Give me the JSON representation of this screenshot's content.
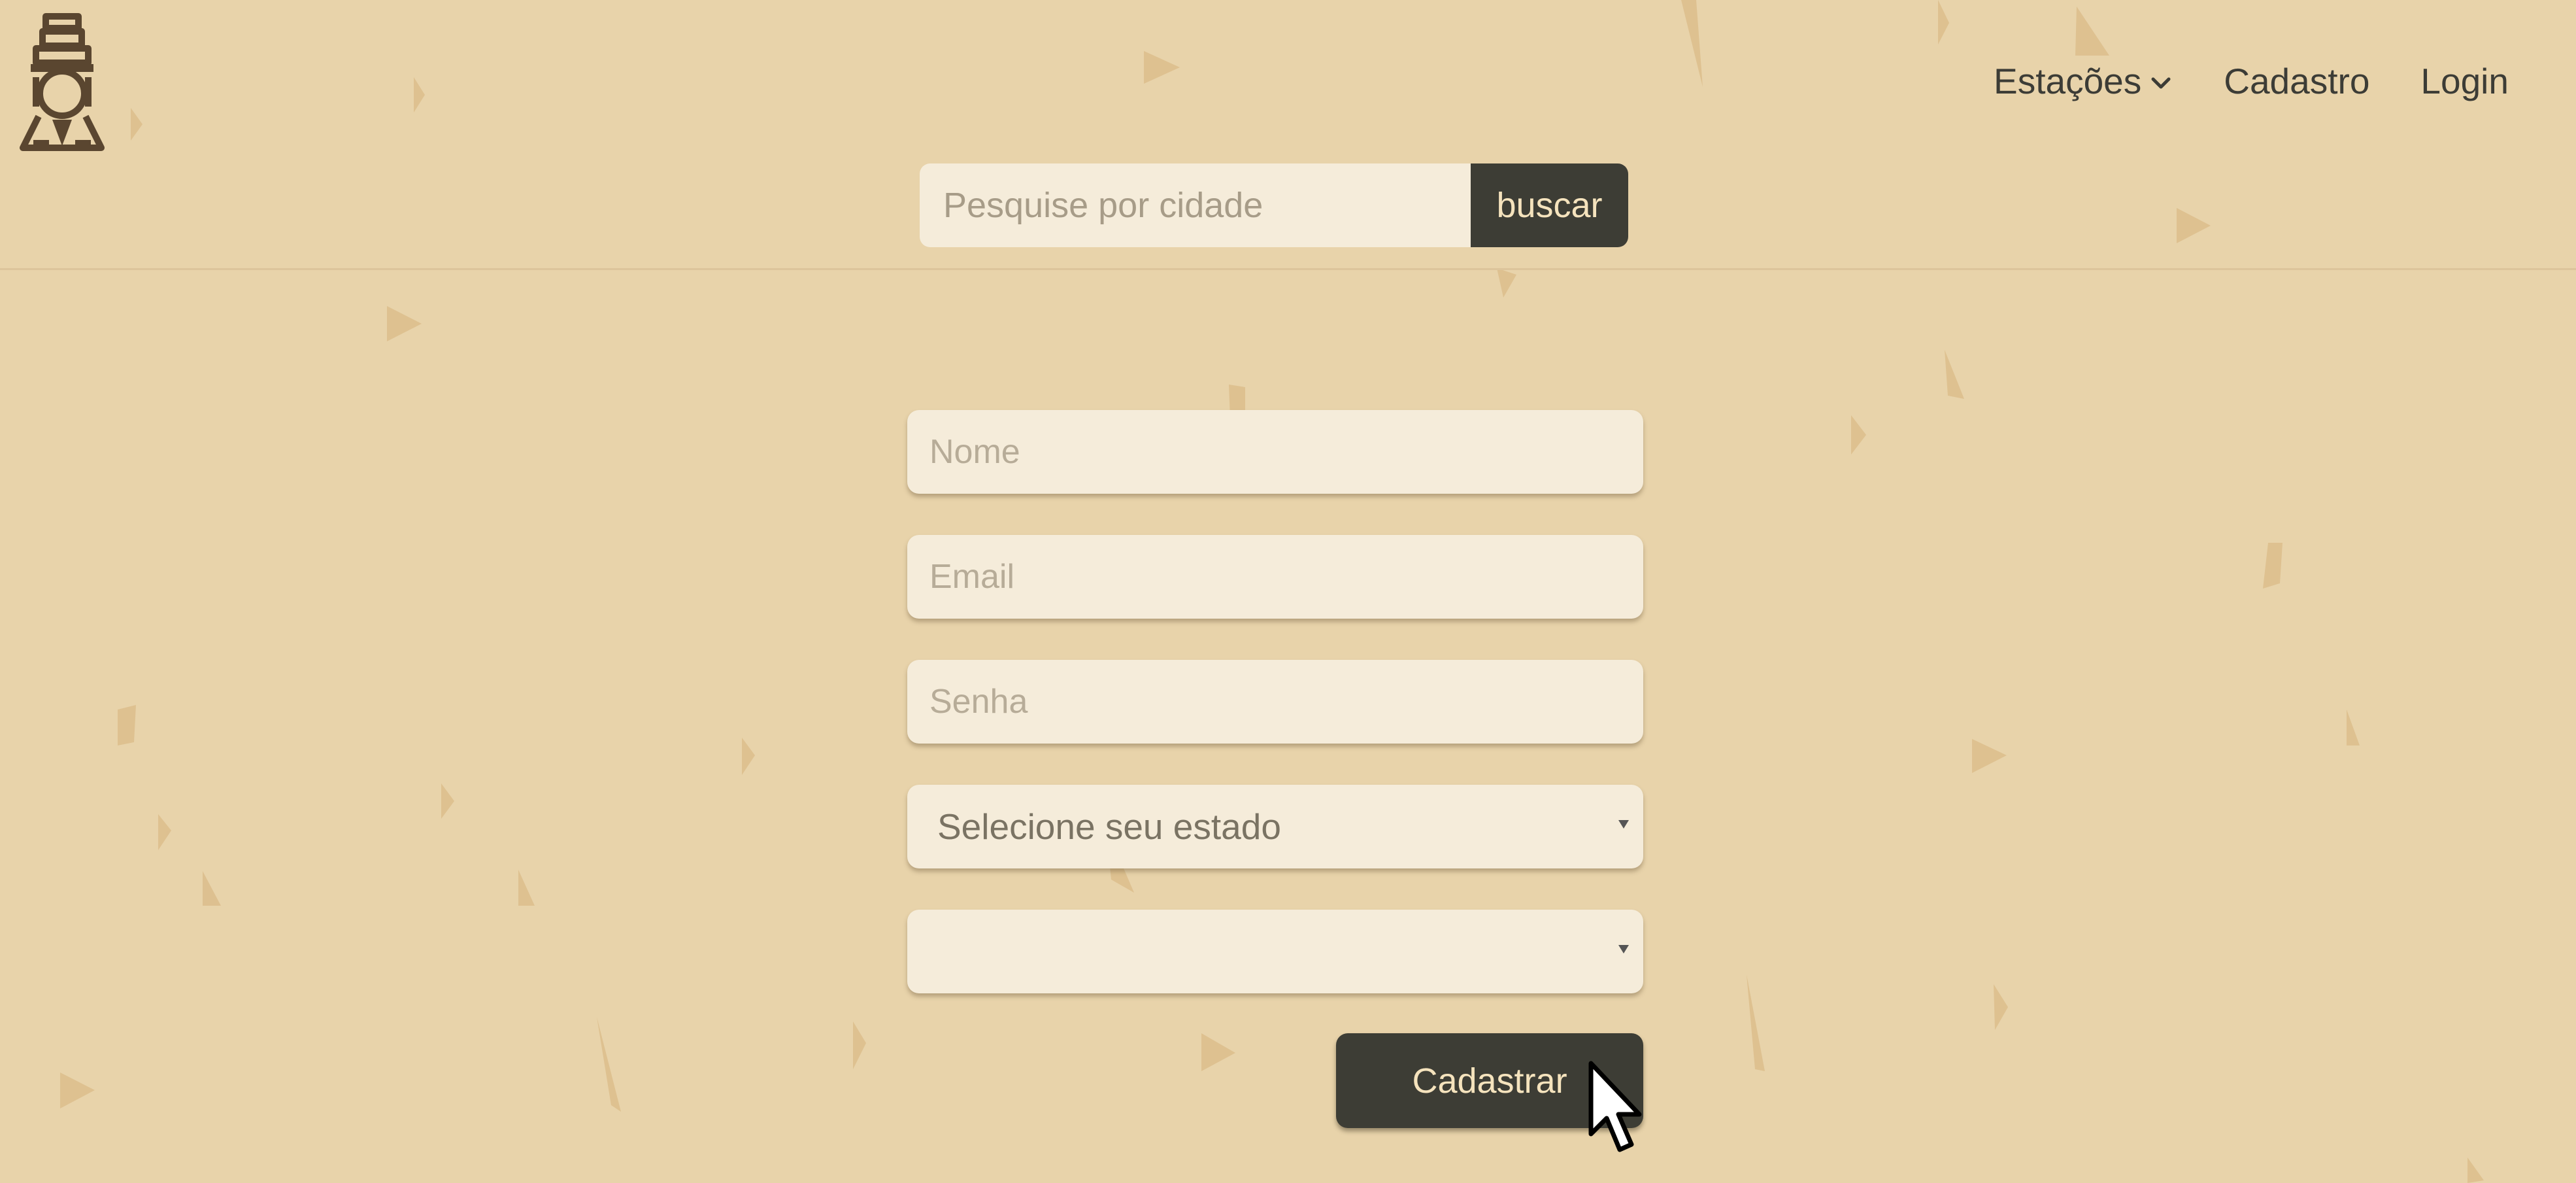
{
  "header": {
    "logo": {
      "icon": "locomotive-icon",
      "color": "#5a4630"
    },
    "nav": {
      "items": [
        {
          "label": "Estações",
          "icon": "chevron-down-icon"
        },
        {
          "label": "Cadastro"
        },
        {
          "label": "Login"
        }
      ]
    },
    "search": {
      "placeholder": "Pesquise por cidade",
      "value": "",
      "button_label": "buscar"
    }
  },
  "form": {
    "name_placeholder": "Nome",
    "email_placeholder": "Email",
    "password_placeholder": "Senha",
    "state_select": {
      "selected": "Selecione seu estado"
    },
    "city_select": {
      "selected": ""
    },
    "submit_label": "Cadastrar"
  },
  "colors": {
    "background": "#e8d3aa",
    "input_background": "#f5ecda",
    "button_background": "#3d3d35",
    "button_text": "#f5e3bd",
    "nav_text": "#3c3c36"
  }
}
